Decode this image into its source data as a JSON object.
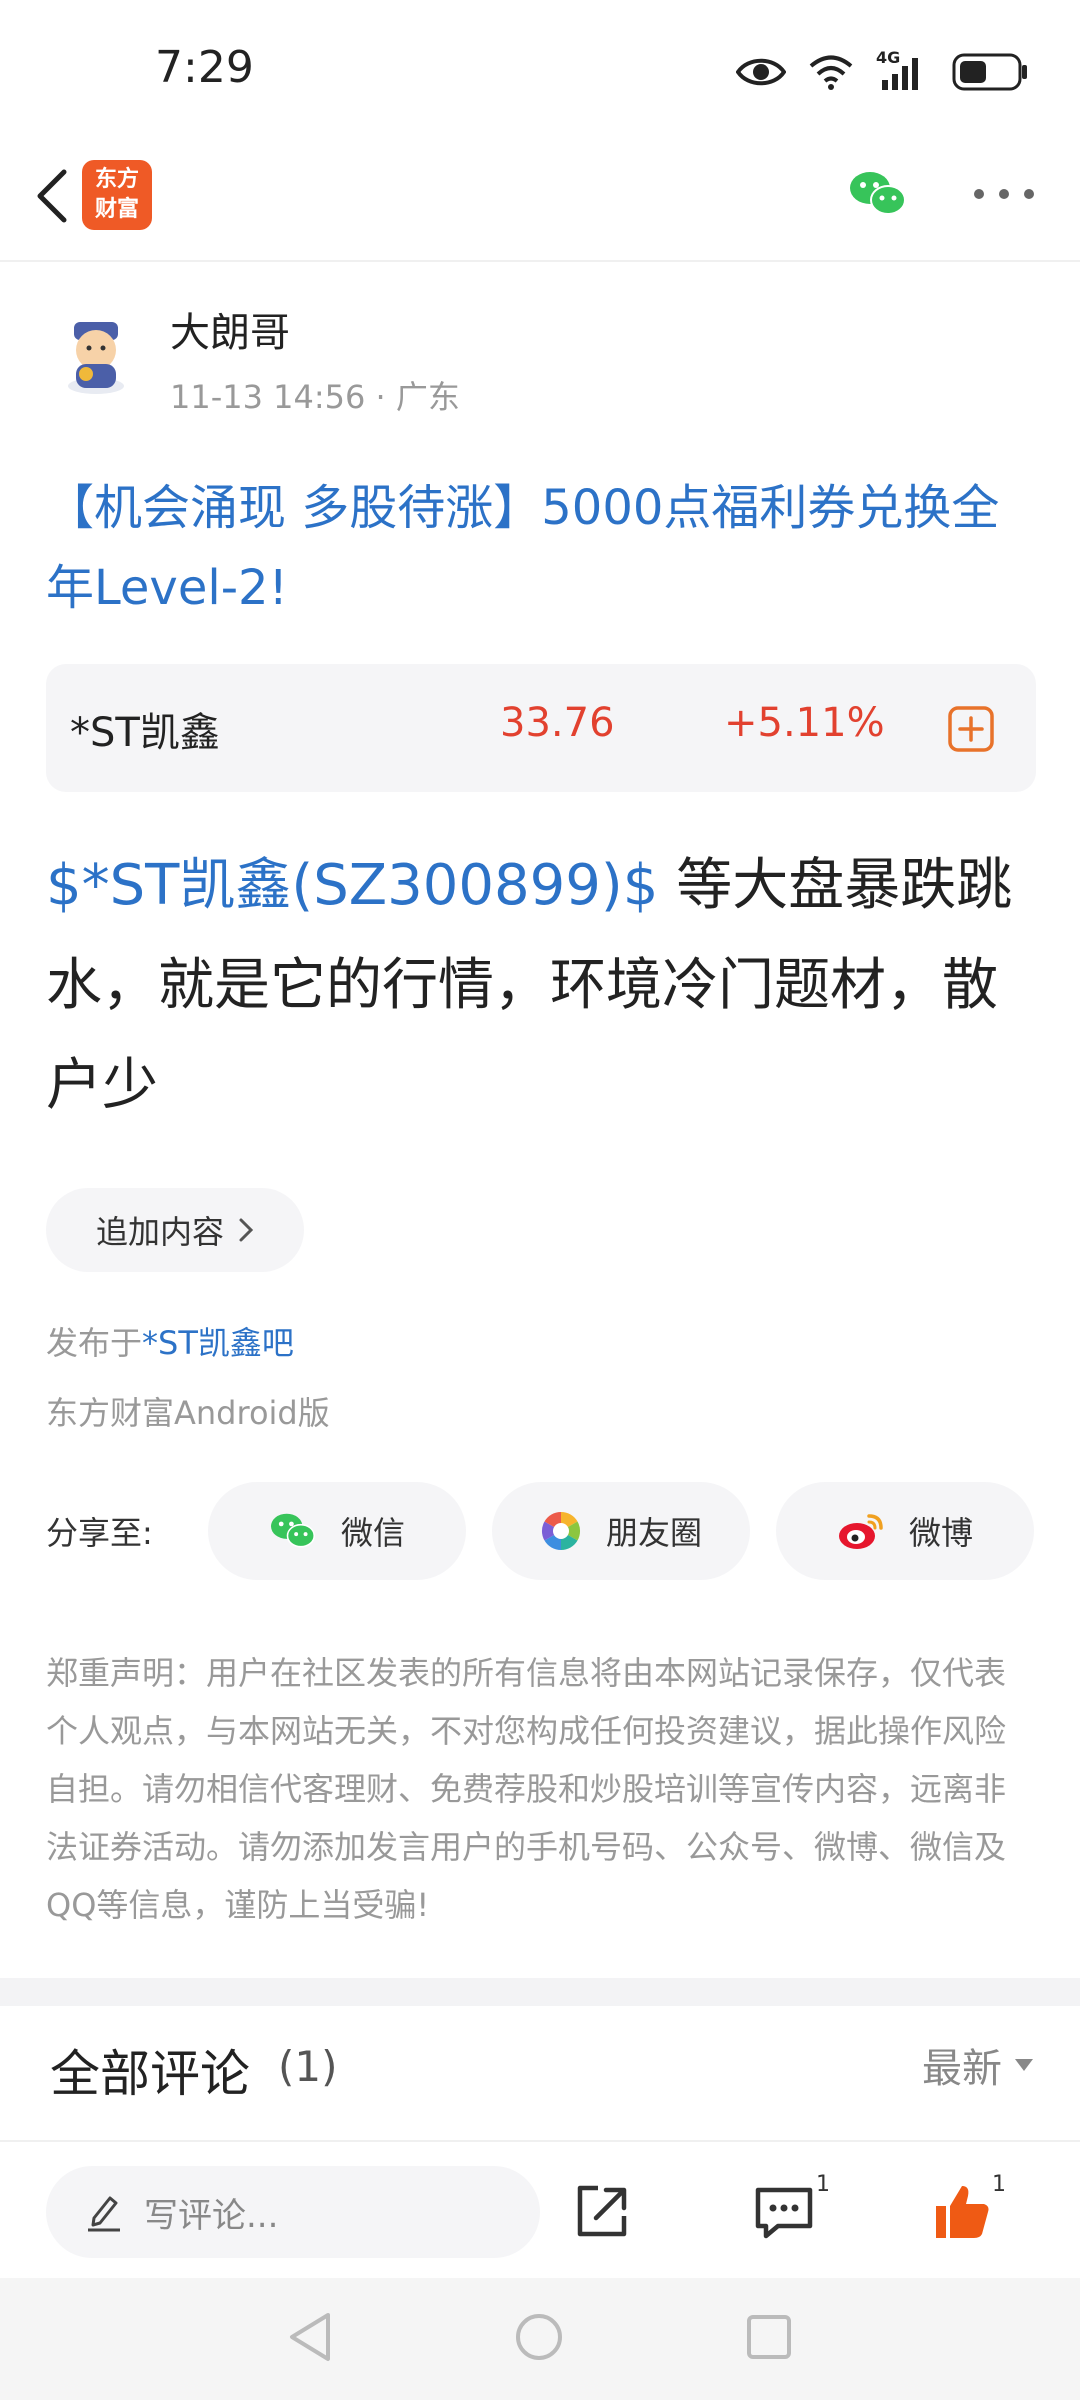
{
  "status_bar": {
    "time": "7:29",
    "network": "4G"
  },
  "nav": {
    "back_icon": "back-chevron-icon",
    "logo_text_line1": "东方",
    "logo_text_line2": "财富",
    "share_icon": "wechat-icon",
    "more_icon": "more-dots-icon"
  },
  "post": {
    "author": "大朗哥",
    "meta": "11-13 14:56  · 广东",
    "title": "【机会涌现 多股待涨】5000点福利券兑换全年Level-2!",
    "stock": {
      "name": "*ST凯鑫",
      "price": "33.76",
      "change": "+5.11%"
    },
    "body_tag": "$*ST凯鑫(SZ300899)$",
    "body_text": " 等大盘暴跌跳水，就是它的行情，环境冷门题材，散户少",
    "append_label": "追加内容",
    "published_prefix": "发布于",
    "published_bar": "*ST凯鑫吧",
    "client": "东方财富Android版"
  },
  "share": {
    "label": "分享至:",
    "items": [
      {
        "label": "微信",
        "icon": "wechat-icon"
      },
      {
        "label": "朋友圈",
        "icon": "moments-icon"
      },
      {
        "label": "微博",
        "icon": "weibo-icon"
      }
    ]
  },
  "disclaimer": "郑重声明：用户在社区发表的所有信息将由本网站记录保存，仅代表个人观点，与本网站无关，不对您构成任何投资建议，据此操作风险自担。请勿相信代客理财、免费荐股和炒股培训等宣传内容，远离非法证券活动。请勿添加发言用户的手机号码、公众号、微博、微信及QQ等信息，谨防上当受骗!",
  "comments": {
    "title": "全部评论",
    "count": "(1)",
    "sort": "最新"
  },
  "bottom_bar": {
    "input_placeholder": "写评论...",
    "comment_count": "1",
    "like_count": "1"
  },
  "colors": {
    "brand": "#ef5a26",
    "link": "#2c72c7",
    "up": "#e2412f",
    "like": "#ef5a14"
  }
}
